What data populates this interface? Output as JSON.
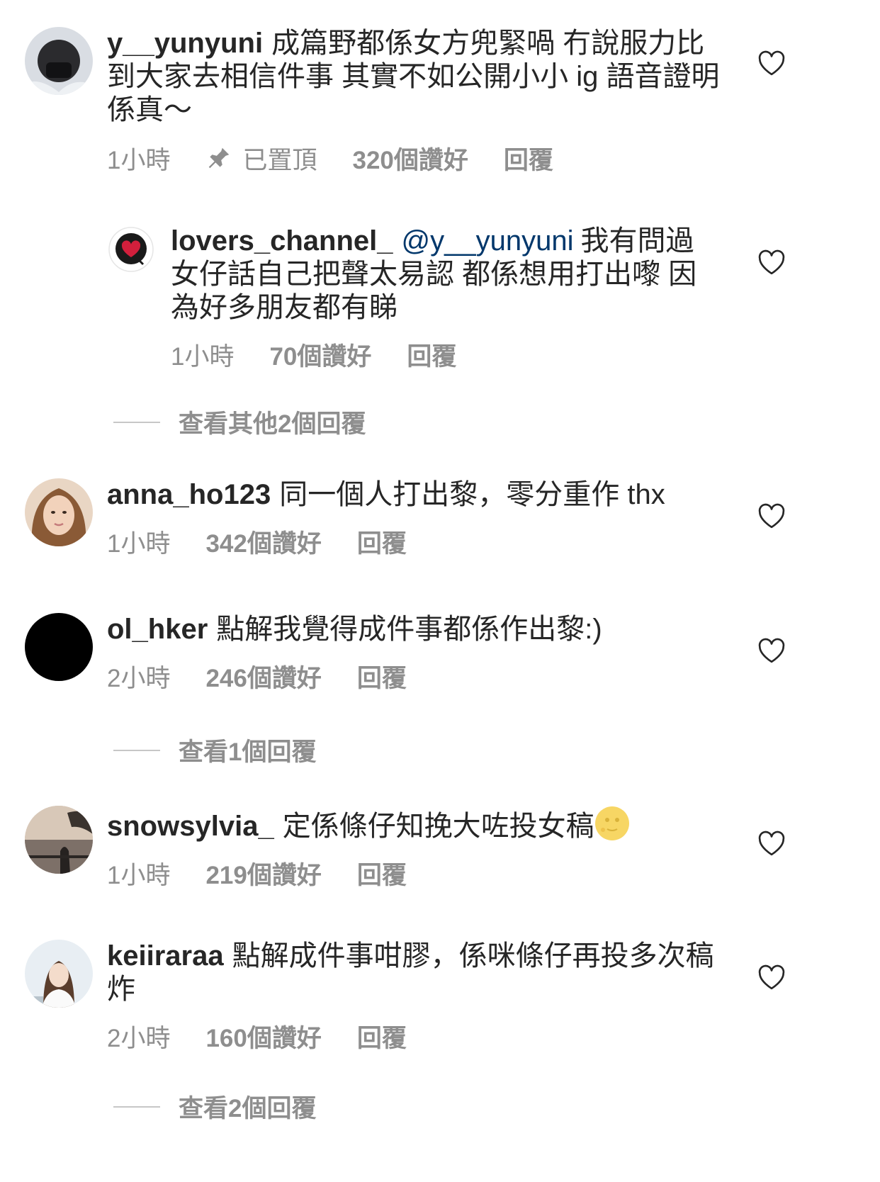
{
  "comments": [
    {
      "username": "y__yunyuni",
      "text": "成篇野都係女方兜緊喎 冇說服力比到大家去相信件事 其實不如公開小小 ig 語音證明係真～",
      "time": "1小時",
      "pinned": "已置頂",
      "likes": "320個讚好",
      "reply": "回覆"
    },
    {
      "username": "lovers_channel_",
      "mention": "@y__yunyuni",
      "text": "我有問過女仔話自己把聲太易認 都係想用打出嚟 因為好多朋友都有睇",
      "time": "1小時",
      "likes": "70個讚好",
      "reply": "回覆"
    },
    {
      "username": "anna_ho123",
      "text": "同一個人打出黎，零分重作 thx",
      "time": "1小時",
      "likes": "342個讚好",
      "reply": "回覆"
    },
    {
      "username": "ol_hker",
      "text": "點解我覺得成件事都係作出黎:)",
      "time": "2小時",
      "likes": "246個讚好",
      "reply": "回覆"
    },
    {
      "username": "snowsylvia_",
      "text": "定係條仔知挽大咗投女稿",
      "time": "1小時",
      "likes": "219個讚好",
      "reply": "回覆"
    },
    {
      "username": "keiiraraa",
      "text": "點解成件事咁膠，係咪條仔再投多次稿炸",
      "time": "2小時",
      "likes": "160個讚好",
      "reply": "回覆"
    }
  ],
  "view_more": [
    "查看其他2個回覆",
    "查看1個回覆",
    "查看2個回覆"
  ],
  "icons": {
    "heart": "heart-outline-icon",
    "pin": "pin-icon",
    "emoji": "full-moon-face-emoji"
  },
  "colors": {
    "text": "#262626",
    "secondary": "#8e8e8e",
    "mention": "#00376b"
  }
}
